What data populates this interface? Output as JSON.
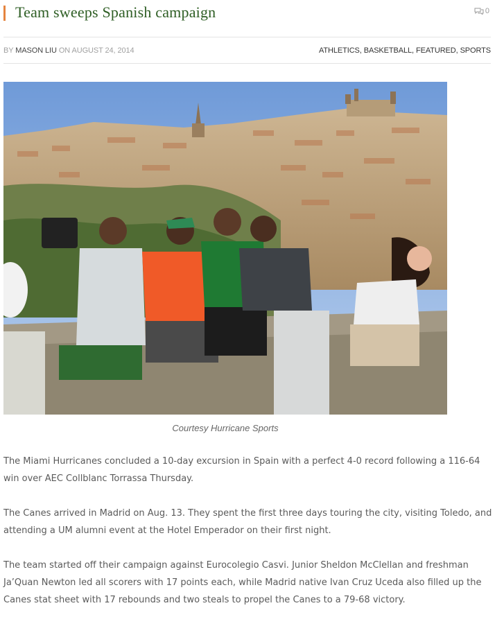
{
  "post": {
    "title": "Team sweeps Spanish campaign",
    "comment_count": "0"
  },
  "meta": {
    "by_label": "BY",
    "author": "MASON LIU",
    "on_label": "ON",
    "date": "AUGUST 24, 2014",
    "categories": [
      "ATHLETICS",
      "BASKETBALL",
      "FEATURED",
      "SPORTS"
    ],
    "separator": ", "
  },
  "photo": {
    "caption": "Courtesy Hurricane Sports"
  },
  "body": {
    "paragraphs": [
      "The Miami Hurricanes concluded a 10-day excursion in Spain with a perfect 4-0 record following a 116-64 win over AEC Collblanc Torrassa Thursday.",
      "The Canes arrived in Madrid on Aug. 13. They spent the first three days touring the city, visiting Toledo, and attending a UM alumni event at the Hotel Emperador on their first night.",
      "The team started off their campaign against Eurocolegio Casvi. Junior Sheldon McClellan and freshman Ja’Quan Newton led all scorers with 17 points each, while Madrid native Ivan Cruz Uceda also filled up the Canes stat sheet with 17 rebounds and two steals to propel the Canes to a 79-68 victory."
    ]
  },
  "colors": {
    "title_accent": "#e5843f",
    "title_text": "#2e5e24"
  },
  "icons": {
    "comments": "speech-bubbles-icon"
  }
}
